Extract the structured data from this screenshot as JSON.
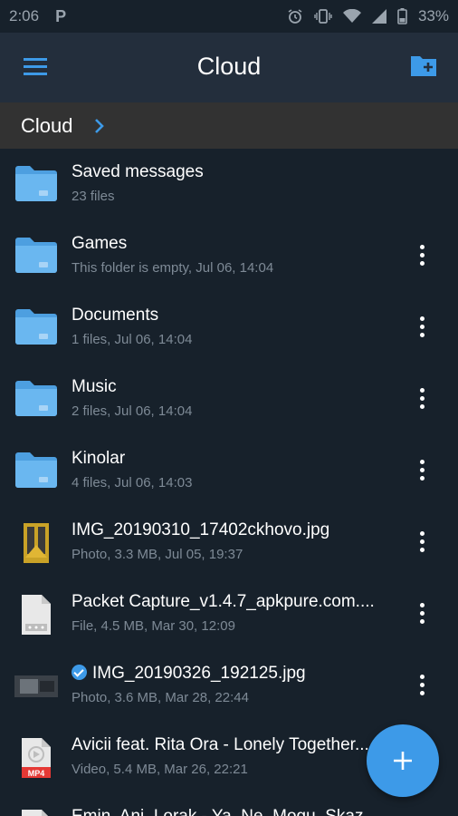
{
  "status_bar": {
    "time": "2:06",
    "battery": "33%"
  },
  "app_bar": {
    "title": "Cloud"
  },
  "breadcrumb": {
    "items": [
      "Cloud"
    ]
  },
  "colors": {
    "background": "#17212b",
    "app_bar": "#232e3c",
    "breadcrumb_bar": "#323232",
    "accent": "#3d9ae8",
    "folder": "#6ab7f0",
    "meta_text": "#7e8a96"
  },
  "files": [
    {
      "name": "Saved messages",
      "meta": "23 files",
      "icon": "folder-icon",
      "has_menu": false
    },
    {
      "name": "Games",
      "meta": "This folder is empty, Jul 06, 14:04",
      "icon": "folder-icon",
      "has_menu": true
    },
    {
      "name": "Documents",
      "meta": "1 files, Jul 06, 14:04",
      "icon": "folder-icon",
      "has_menu": true
    },
    {
      "name": "Music",
      "meta": "2 files, Jul 06, 14:04",
      "icon": "folder-icon",
      "has_menu": true
    },
    {
      "name": "Kinolar",
      "meta": "4 files, Jul 06, 14:03",
      "icon": "folder-icon",
      "has_menu": true
    },
    {
      "name": "IMG_20190310_17402ckhovo.jpg",
      "meta": "Photo, 3.3 MB, Jul 05, 19:37",
      "icon": "photo-thumbnail-icon",
      "has_menu": true
    },
    {
      "name": "Packet Capture_v1.4.7_apkpure.com....",
      "meta": "File, 4.5 MB, Mar 30, 12:09",
      "icon": "file-icon",
      "has_menu": true
    },
    {
      "name": "IMG_20190326_192125.jpg",
      "meta": "Photo, 3.6 MB, Mar 28, 22:44",
      "icon": "photo-thumbnail-icon",
      "has_menu": true,
      "checked": true
    },
    {
      "name": "Avicii feat. Rita Ora - Lonely Together...",
      "meta": "Video, 5.4 MB, Mar 26, 22:21",
      "icon": "mp4-file-icon",
      "badge": "MP4",
      "has_menu": false
    },
    {
      "name": "Emin, Ani, Lorak - Ya, Ne, Mogu, Skaz",
      "meta": "",
      "icon": "file-icon",
      "has_menu": false,
      "partial": true
    }
  ]
}
